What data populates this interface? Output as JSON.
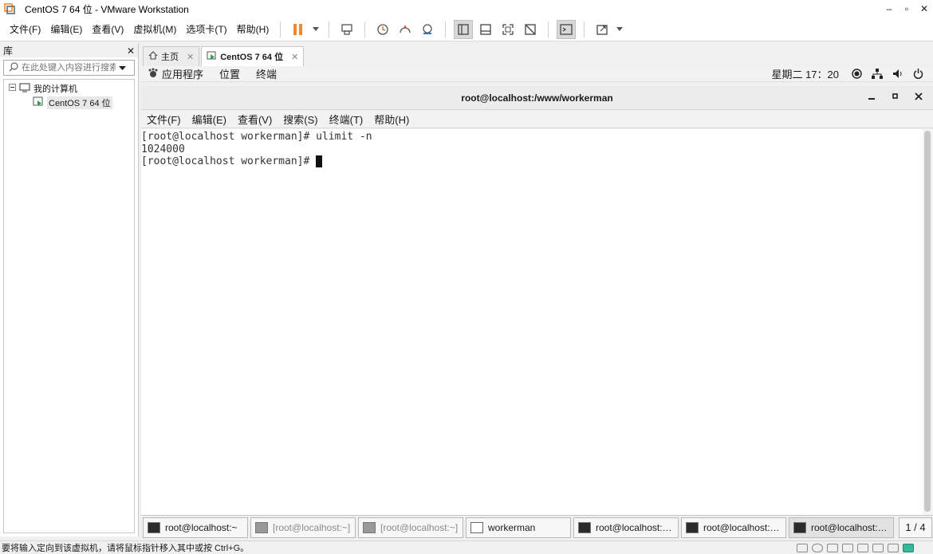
{
  "window": {
    "title": "CentOS 7 64 位 - VMware Workstation",
    "controls": [
      "–",
      "▫",
      "✕"
    ]
  },
  "menubar": {
    "items": [
      "文件(F)",
      "编辑(E)",
      "查看(V)",
      "虚拟机(M)",
      "选项卡(T)",
      "帮助(H)"
    ]
  },
  "toolbar": {
    "icons": [
      "pause-icon",
      "dropdown-arrow-icon",
      "send-ctrl-alt-del-icon",
      "snapshot-icon",
      "revert-snapshot-icon",
      "snapshot-manager-icon",
      "show-library-icon",
      "thumbnail-bar-icon",
      "fullscreen-icon",
      "unity-icon",
      "console-view-icon",
      "stretch-icon"
    ]
  },
  "library": {
    "title": "库",
    "close": "✕",
    "search_placeholder": "在此处键入内容进行搜索",
    "tree": {
      "root": "我的计算机",
      "child": "CentOS 7 64 位"
    }
  },
  "tabs": [
    {
      "label": "主页",
      "close": "✕"
    },
    {
      "label": "CentOS 7 64 位",
      "close": "✕"
    }
  ],
  "guest_topbar": {
    "apps": "应用程序",
    "places": "位置",
    "terminal": "终端",
    "clock": "星期二 17：20"
  },
  "terminal": {
    "title": "root@localhost:/www/workerman",
    "menu": [
      "文件(F)",
      "编辑(E)",
      "查看(V)",
      "搜索(S)",
      "终端(T)",
      "帮助(H)"
    ],
    "lines": [
      "[root@localhost workerman]# ulimit -n",
      "1024000",
      "[root@localhost workerman]# "
    ]
  },
  "guest_taskbar": {
    "items": [
      {
        "label": "root@localhost:~",
        "state": "normal",
        "icon": "terminal-icon"
      },
      {
        "label": "[root@localhost:~]",
        "state": "dim",
        "icon": "terminal-icon"
      },
      {
        "label": "[root@localhost:~]",
        "state": "dim",
        "icon": "terminal-icon"
      },
      {
        "label": "workerman",
        "state": "normal",
        "icon": "document-icon"
      },
      {
        "label": "root@localhost:…",
        "state": "normal",
        "icon": "terminal-icon"
      },
      {
        "label": "root@localhost:…",
        "state": "normal",
        "icon": "terminal-icon"
      },
      {
        "label": "root@localhost:…",
        "state": "active",
        "icon": "terminal-icon"
      }
    ],
    "pager": "1 / 4"
  },
  "statusbar": {
    "message": "要将输入定向到该虚拟机，请将鼠标指针移入其中或按 Ctrl+G。"
  },
  "colors": {
    "vmware_orange": "#f08a24",
    "status_green": "#3cb59b"
  }
}
